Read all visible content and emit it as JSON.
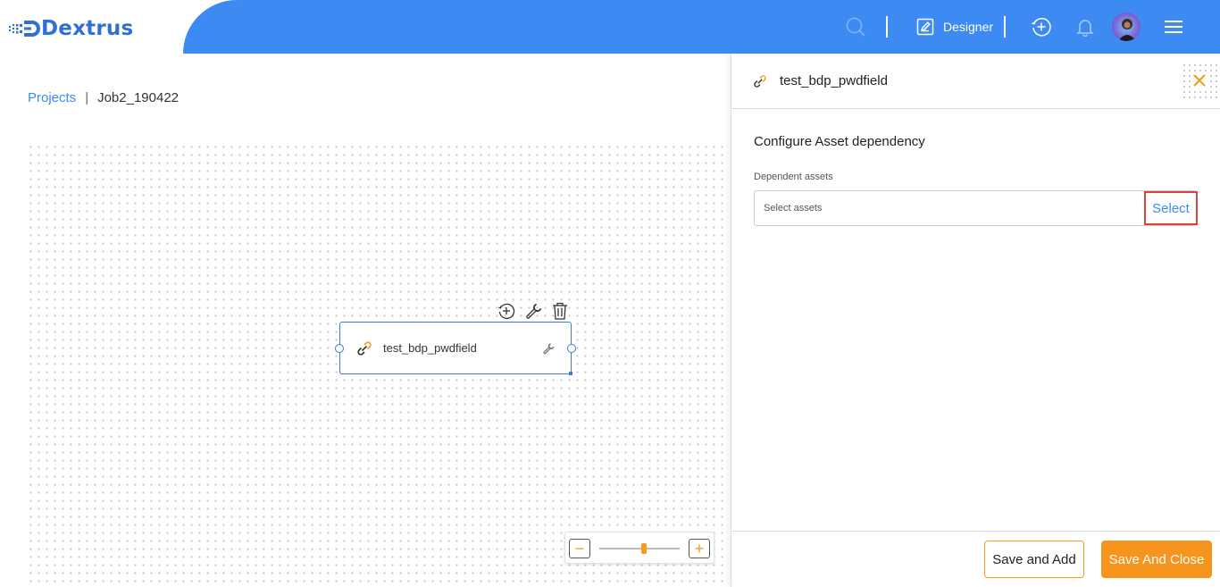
{
  "app": {
    "brand": "Dextrus"
  },
  "header": {
    "mode_label": "Designer",
    "icons": [
      "search-icon",
      "edit-icon",
      "add-circle-icon",
      "bell-icon",
      "avatar",
      "menu-icon"
    ]
  },
  "breadcrumb": {
    "root": "Projects",
    "separator": "|",
    "current": "Job2_190422"
  },
  "canvas": {
    "node": {
      "label": "test_bdp_pwdfield",
      "icon": "link-icon"
    },
    "node_tools": [
      "add-circle-icon",
      "wrench-icon",
      "trash-icon"
    ],
    "zoom": {
      "minus": "−",
      "plus": "+",
      "level": 0.55
    }
  },
  "panel": {
    "title": "test_bdp_pwdfield",
    "section_title": "Configure Asset dependency",
    "field_label": "Dependent assets",
    "field_placeholder": "Select assets",
    "select_label": "Select",
    "save_add_label": "Save and Add",
    "save_close_label": "Save And Close"
  },
  "colors": {
    "brand_blue": "#3d8bf2",
    "accent_orange": "#f7941d",
    "highlight_red": "#e0413a"
  }
}
